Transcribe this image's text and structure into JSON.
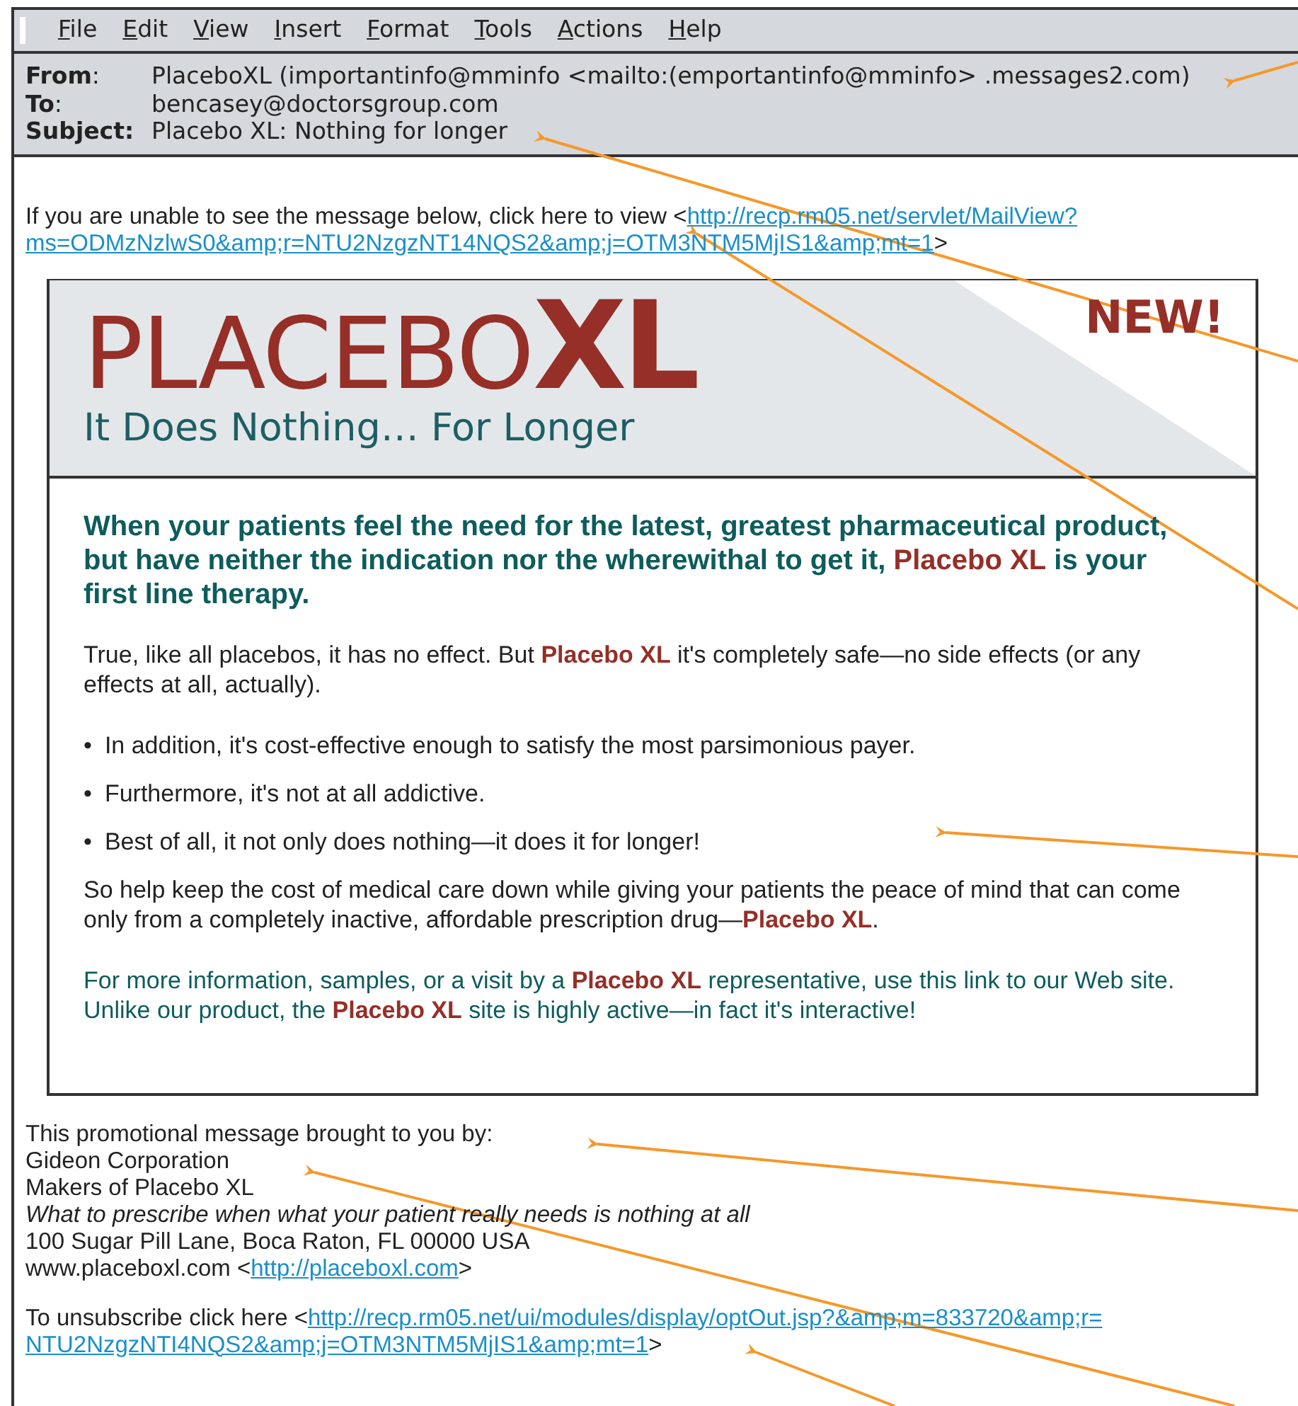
{
  "menu": [
    {
      "label": "File"
    },
    {
      "label": "Edit"
    },
    {
      "label": "View"
    },
    {
      "label": "Insert"
    },
    {
      "label": "Format"
    },
    {
      "label": "Tools"
    },
    {
      "label": "Actions"
    },
    {
      "label": "Help"
    }
  ],
  "header": [
    {
      "label": "**From**:",
      "value": "PlaceboXL (importantinfo@mminfo <mailto:(emportantinfo@mminfo> .messages2.com)"
    },
    {
      "label": "**To**:",
      "value": "bencasey@doctorsgroup.com"
    },
    {
      "label": "**Subject:**",
      "value": "Placebo XL: Nothing for longer"
    }
  ],
  "notice": {
    "text": "If you are unable to see the message below, click here to view <",
    "link_lines": [
      "http://recp.rm05.net/servlet/MailView?",
      "ms=ODMzNzlwS0&amp;r=NTU2NzgzNT14NQS2&amp;j=OTM3NTM5MjIS1&amp;mt=1"
    ],
    "after": ">"
  },
  "banner": {
    "brand": "PLACEBO",
    "brand_bold": "XL",
    "badge": "NEW!",
    "tagline": "It Does Nothing… For Longer"
  },
  "lead": "When your patients feel the need for the latest, greatest pharmaceutical product, but have neither the indication nor the wherewithal to get it, **Placebo XL** is your first line therapy.",
  "paragraphs": [
    {
      "kind": "plain",
      "text": "True, like all placebos, it has no effect. But **Placebo XL** it's completely safe—no side effects (or any effects at all, actually)."
    }
  ],
  "bullets": [
    {
      "bullet": "•",
      "text": "In addition, it's cost-effective enough to satisfy the most parsimonious payer."
    },
    {
      "bullet": "•",
      "text": "Furthermore, it's not at all addictive."
    },
    {
      "bullet": "•",
      "text": "Best of all, it not only does nothing—it  does it for longer!"
    }
  ],
  "closing": [
    {
      "kind": "plain",
      "text": "So help keep the cost of medical care down while giving your patients the peace of mind that can come only from a completely inactive, affordable prescription drug—**Placebo XL**."
    },
    {
      "kind": "teal",
      "text": "For more information, samples, or a visit by a **Placebo XL** representative, use this link to our Web site. Unlike our product, the **Placebo XL** site is highly active—in fact it's interactive!"
    }
  ],
  "footer": [
    {
      "kind": "plain",
      "text": "This promotional message brought to you by:"
    },
    {
      "kind": "plain",
      "text": "Gideon Corporation"
    },
    {
      "kind": "plain",
      "text": "Makers of Placebo XL"
    },
    {
      "kind": "italic",
      "text": "What to prescribe when what your patient really needs is nothing at all"
    },
    {
      "kind": "plain",
      "text": "100 Sugar Pill Lane, Boca Raton, FL 00000 USA"
    }
  ],
  "website": {
    "text": "www.placeboxl.com <",
    "link": "http://placeboxl.com",
    "after": ">"
  },
  "unsubscribe": {
    "text": "To unsubscribe click here <",
    "link_lines": [
      "http://recp.rm05.net/ui/modules/display/optOut.jsp?&amp;m=833720&amp;r=",
      "NTU2NzgzNTI4NQS2&amp;j=OTM3NTM5MjIS1&amp;mt=1"
    ],
    "after": ">"
  }
}
